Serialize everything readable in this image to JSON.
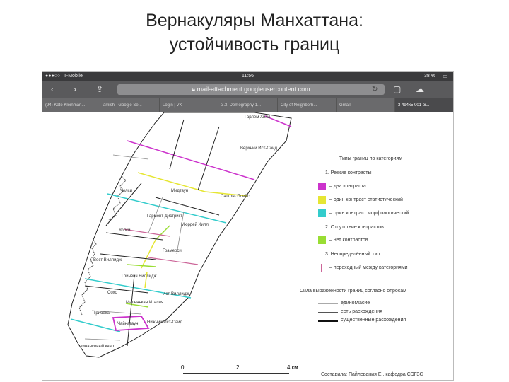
{
  "slide": {
    "title_line1": "Вернакуляры Манхаттана:",
    "title_line2": "устойчивость границ"
  },
  "status": {
    "carrier": "T-Mobile",
    "time": "11:56",
    "battery": "38 %"
  },
  "browser": {
    "url": "mail-attachment.googleusercontent.com",
    "tabs": [
      "(94) Kate Kleinman...",
      "amish - Google Se...",
      "Login | VK",
      "3.3. Demography 1...",
      "City of Neighborh...",
      "Gmail",
      "3 494x5 001 pi..."
    ]
  },
  "map": {
    "labels": {
      "harlem": "Гарлем\nХилл",
      "upper_east": "Верхний\nИст-Сайд",
      "chelsea": "Челси",
      "midtown": "Мидтаун",
      "sutton": "Саттон-\nПлейс",
      "garment": "Гармент\nДистрикт",
      "murray": "Мюррей Хилл",
      "village": "Уолси",
      "gramercy": "Грамерси",
      "west_village": "Вест\nВиллидж",
      "greenwich": "Гринвич Виллидж",
      "east_village": "Ист-Виллидж",
      "soho": "Сохо",
      "little_italy": "Маленькая\nИталия",
      "tribeca": "Трибека",
      "chinatown": "Чайнатаун",
      "lower_east": "Нижний Ист-Сайд",
      "financial": "Финансовый\nкварт"
    }
  },
  "legend": {
    "title": "Типы границ по категориям",
    "cat1": "1. Резкие контрасты",
    "item_two": "– два контраста",
    "item_stat": "– один контраст статистический",
    "item_morph": "– один контраст морфологический",
    "cat2": "2. Отсутствие контрастов",
    "item_none": "– нет контрастов",
    "cat3": "3. Неопределённый тип",
    "item_trans": "– переходный между категориями",
    "strength_title": "Сила выраженности границ согласно опросам",
    "str_agree": "единогласие",
    "str_some": "есть расхождения",
    "str_big": "существенные расхождения",
    "colors": {
      "two": "#cc33cc",
      "stat": "#e6e633",
      "morph": "#33cccc",
      "none": "#99dd33",
      "trans": "#cc6699"
    }
  },
  "scale": {
    "t0": "0",
    "t2": "2",
    "t4": "4 км"
  },
  "credits": "Составила: Пайлевания Е., кафедра СЭГЗС"
}
